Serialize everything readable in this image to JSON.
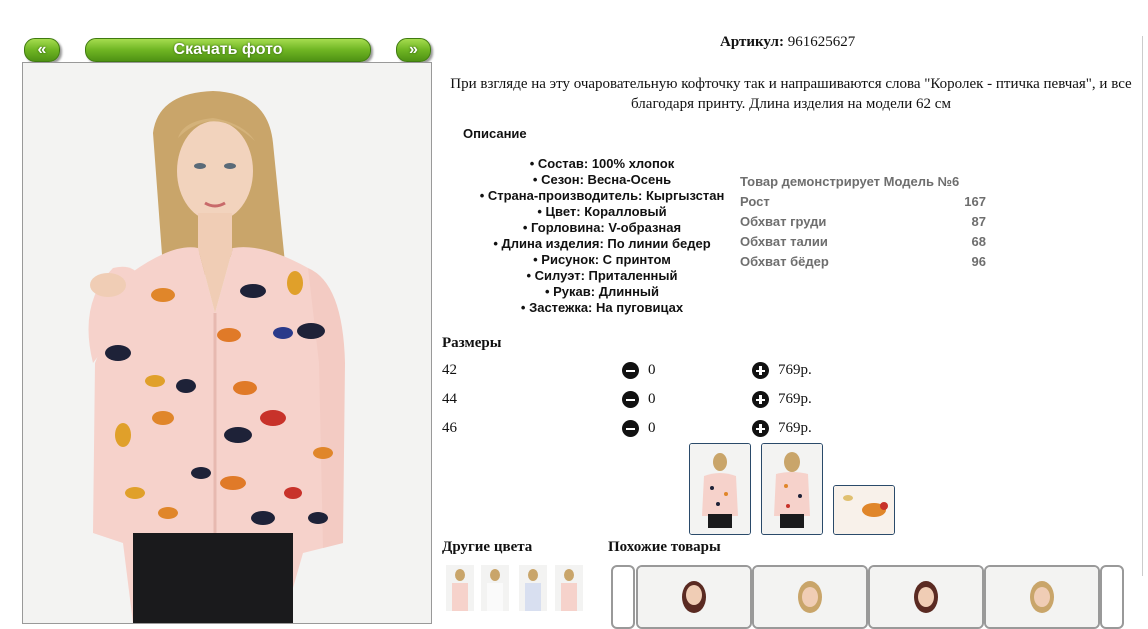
{
  "nav": {
    "prev_label": "«",
    "download_label": "Скачать фото",
    "next_label": "»"
  },
  "product": {
    "article_label": "Артикул:",
    "article_value": "961625627",
    "description": "При взгляде на эту очаровательную кофточку так и напрашиваются слова \"Королек - птичка певчая\", и все благодаря принту. Длина изделия на модели 62 см",
    "specs_title": "Описание",
    "specs": [
      "• Состав: 100% хлопок",
      "• Сезон: Весна-Осень",
      "• Страна-производитель: Кыргызстан",
      "• Цвет: Коралловый",
      "• Горловина: V-образная",
      "• Длина изделия: По линии бедер",
      "• Рисунок: С принтом",
      "• Силуэт: Приталенный",
      "• Рукав: Длинный",
      "• Застежка: На пуговицах"
    ]
  },
  "model": {
    "title": "Товар демонстрирует Модель №6",
    "rows": [
      {
        "label": "Рост",
        "value": "167"
      },
      {
        "label": "Обхват груди",
        "value": "87"
      },
      {
        "label": "Обхват талии",
        "value": "68"
      },
      {
        "label": "Обхват бёдер",
        "value": "96"
      }
    ]
  },
  "sizes": {
    "title": "Размеры",
    "rows": [
      {
        "size": "42",
        "qty": "0",
        "price": "769р."
      },
      {
        "size": "44",
        "qty": "0",
        "price": "769р."
      },
      {
        "size": "46",
        "qty": "0",
        "price": "769р."
      }
    ]
  },
  "sections": {
    "other_colors": "Другие цвета",
    "similar": "Похожие товары"
  },
  "colors": {
    "shirt": "#f6d2cb",
    "accent_green": "#6fb523",
    "bird_dark": "#1e2238",
    "bird_orange": "#e0862a",
    "bird_red": "#c8322a"
  }
}
